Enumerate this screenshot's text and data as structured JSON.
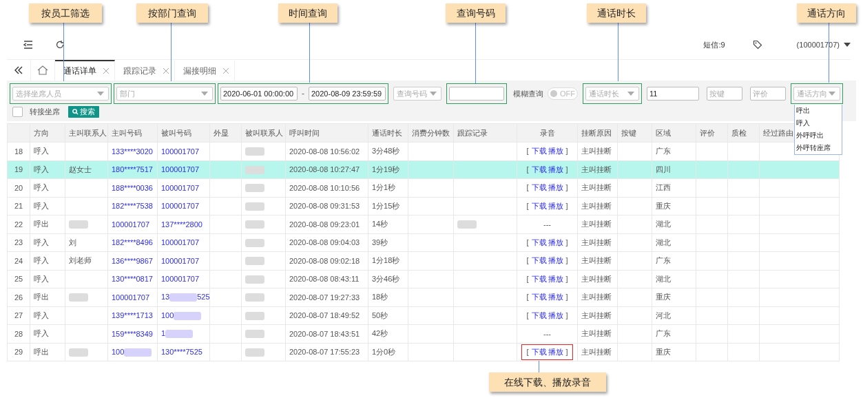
{
  "callouts": [
    {
      "label": "按员工筛选"
    },
    {
      "label": "按部门查询"
    },
    {
      "label": "时间查询"
    },
    {
      "label": "查询号码"
    },
    {
      "label": "通话时长"
    },
    {
      "label": "通话方向"
    },
    {
      "label": "在线下载、播放录音"
    }
  ],
  "header": {
    "sms": "短信:9",
    "account": "(100001707)"
  },
  "tabs": [
    {
      "label": "通话详单",
      "selected": true
    },
    {
      "label": "跟踪记录",
      "selected": false
    },
    {
      "label": "漏接明细",
      "selected": false
    }
  ],
  "filters": [
    {
      "kind": "select",
      "placeholder": "选择坐席人员",
      "framed": true
    },
    {
      "kind": "select",
      "placeholder": "部门",
      "framed": true
    },
    {
      "kind": "daterange",
      "from": "2020-06-01 00:00:00",
      "sep": "-",
      "to": "2020-08-09 23:59:59",
      "framed": true
    },
    {
      "kind": "select",
      "placeholder": "查询号码",
      "framed": false
    },
    {
      "kind": "input",
      "framed": true
    },
    {
      "kind": "toggle",
      "label": "模糊查询",
      "on": false,
      "state_label": "OFF",
      "framed": false
    },
    {
      "kind": "select",
      "placeholder": "通话时长",
      "framed": true
    },
    {
      "kind": "input",
      "value": "11",
      "framed": false
    },
    {
      "kind": "input",
      "placeholder": "按键",
      "framed": false
    },
    {
      "kind": "input",
      "placeholder": "评价",
      "framed": false
    },
    {
      "kind": "select",
      "placeholder": "通话方向",
      "framed": true,
      "options": [
        "呼出",
        "呼入",
        "外呼呼出",
        "外呼转座席"
      ]
    }
  ],
  "transfer": {
    "label": "转接坐席",
    "checked": false
  },
  "search_button": "搜索",
  "columns": [
    {
      "kind": "num"
    },
    {
      "label": "方向",
      "kind": "text"
    },
    {
      "label": "主叫联系人",
      "kind": "text"
    },
    {
      "label": "主叫号码",
      "kind": "link"
    },
    {
      "label": "被叫号码",
      "kind": "link"
    },
    {
      "label": "外显",
      "kind": "text"
    },
    {
      "label": "被叫联系人",
      "kind": "text"
    },
    {
      "label": "呼叫时间",
      "kind": "text"
    },
    {
      "label": "通话时长",
      "kind": "text"
    },
    {
      "label": "消费分钟数",
      "kind": "text"
    },
    {
      "label": "跟踪记录",
      "kind": "text"
    },
    {
      "label": "录音",
      "kind": "recording"
    },
    {
      "label": "挂断原因",
      "kind": "text"
    },
    {
      "label": "按键",
      "kind": "text"
    },
    {
      "label": "区域",
      "kind": "text"
    },
    {
      "label": "评价",
      "kind": "text"
    },
    {
      "label": "质检",
      "kind": "text"
    },
    {
      "label": "经过路由",
      "kind": "text"
    }
  ],
  "rows": [
    {
      "selected": false,
      "cells": [
        "18",
        "呼入",
        null,
        "133****3020",
        "100001707",
        null,
        {
          "kind": "blurred"
        },
        "2020-08-08 10:56:02",
        "3分48秒",
        null,
        null,
        {
          "kind": "links",
          "open": "[",
          "links": [
            "下载",
            "播放"
          ],
          "close": "]",
          "outlined": false
        },
        "主叫挂断",
        null,
        "广东",
        null,
        null,
        null
      ]
    },
    {
      "selected": true,
      "cells": [
        "19",
        "呼入",
        "赵女士",
        "180****7517",
        "100001707",
        null,
        {
          "kind": "blurred"
        },
        "2020-08-08 10:27:47",
        "1分19秒",
        null,
        null,
        {
          "kind": "links",
          "open": "[",
          "links": [
            "下载",
            "播放"
          ],
          "close": "]",
          "outlined": false
        },
        "主叫挂断",
        null,
        "四川",
        null,
        null,
        null
      ]
    },
    {
      "selected": false,
      "cells": [
        "20",
        "呼入",
        null,
        "188****0036",
        "100001707",
        null,
        {
          "kind": "blurred"
        },
        "2020-08-08 10:10:56",
        "1分1秒",
        null,
        null,
        {
          "kind": "links",
          "open": "[",
          "links": [
            "下载",
            "播放"
          ],
          "close": "]",
          "outlined": false
        },
        "主叫挂断",
        null,
        "江西",
        null,
        null,
        null
      ]
    },
    {
      "selected": false,
      "cells": [
        "21",
        "呼入",
        null,
        "182****7538",
        "100001707",
        null,
        {
          "kind": "blurred"
        },
        "2020-08-08 09:31:53",
        "1分15秒",
        null,
        null,
        {
          "kind": "links",
          "open": "[",
          "links": [
            "下载",
            "播放"
          ],
          "close": "]",
          "outlined": false
        },
        "主叫挂断",
        null,
        "重庆",
        null,
        null,
        null
      ]
    },
    {
      "selected": false,
      "cells": [
        "22",
        "呼出",
        {
          "kind": "blurred"
        },
        "100001707",
        "137****2800",
        null,
        {
          "kind": "blurred"
        },
        "2020-08-08 09:23:01",
        "14秒",
        null,
        {
          "kind": "blurred"
        },
        {
          "kind": "none",
          "text": "---"
        },
        "主叫挂断",
        null,
        "湖北",
        null,
        null,
        null
      ]
    },
    {
      "selected": false,
      "cells": [
        "23",
        "呼入",
        "刘",
        "182****8496",
        "100001707",
        null,
        {
          "kind": "blurred"
        },
        "2020-08-08 09:04:03",
        "39秒",
        null,
        null,
        {
          "kind": "links",
          "open": "[",
          "links": [
            "下载",
            "播放"
          ],
          "close": "]",
          "outlined": false
        },
        "主叫挂断",
        null,
        "湖北",
        null,
        null,
        null
      ]
    },
    {
      "selected": false,
      "cells": [
        "24",
        "呼入",
        "刘老师",
        "136****9867",
        "100001707",
        null,
        {
          "kind": "blurred"
        },
        "2020-08-08 09:02:18",
        "1分18秒",
        null,
        null,
        {
          "kind": "links",
          "open": "[",
          "links": [
            "下载",
            "播放"
          ],
          "close": "]",
          "outlined": false
        },
        "主叫挂断",
        null,
        "广东",
        null,
        null,
        null
      ]
    },
    {
      "selected": false,
      "cells": [
        "25",
        "呼入",
        null,
        "130****0817",
        "100001707",
        null,
        {
          "kind": "blurred"
        },
        "2020-08-08 08:43:11",
        "3分46秒",
        null,
        null,
        {
          "kind": "links",
          "open": "[",
          "links": [
            "下载",
            "播放"
          ],
          "close": "]",
          "outlined": false
        },
        "主叫挂断",
        null,
        "湖北",
        null,
        null,
        null
      ]
    },
    {
      "selected": false,
      "cells": [
        "26",
        "呼出",
        {
          "kind": "blurred"
        },
        "100001707",
        {
          "kind": "blurred",
          "parts": [
            "13",
            "525"
          ]
        },
        null,
        {
          "kind": "blurred"
        },
        "2020-08-07 19:27:33",
        "18秒",
        null,
        null,
        {
          "kind": "links",
          "open": "[",
          "links": [
            "下载",
            "播放"
          ],
          "close": "]",
          "outlined": false
        },
        "主叫挂断",
        null,
        "重庆",
        null,
        null,
        null
      ]
    },
    {
      "selected": false,
      "cells": [
        "27",
        "呼入",
        null,
        "139****1713",
        {
          "kind": "blurred",
          "parts": [
            "100"
          ]
        },
        null,
        {
          "kind": "blurred"
        },
        "2020-08-07 18:49:52",
        "50秒",
        null,
        null,
        {
          "kind": "links",
          "open": "[",
          "links": [
            "下载",
            "播放"
          ],
          "close": "]",
          "outlined": false
        },
        "主叫挂断",
        null,
        "河北",
        null,
        null,
        null
      ]
    },
    {
      "selected": false,
      "cells": [
        "28",
        "呼入",
        null,
        "159****8349",
        {
          "kind": "blurred",
          "parts": [
            "1"
          ]
        },
        null,
        {
          "kind": "blurred"
        },
        "2020-08-07 18:43:51",
        "42秒",
        null,
        null,
        {
          "kind": "none",
          "text": "---"
        },
        "主叫挂断",
        null,
        "广东",
        null,
        null,
        null
      ]
    },
    {
      "selected": false,
      "cells": [
        "29",
        "呼出",
        {
          "kind": "blurred"
        },
        {
          "kind": "blurred",
          "parts": [
            "100"
          ]
        },
        "130****7525",
        null,
        {
          "kind": "blurred"
        },
        "2020-08-07 17:55:23",
        "1分0秒",
        null,
        null,
        {
          "kind": "links",
          "open": "[",
          "links": [
            "下载",
            "播放"
          ],
          "close": "]",
          "outlined": true
        },
        "主叫挂断",
        null,
        "重庆",
        null,
        null,
        null
      ]
    }
  ]
}
